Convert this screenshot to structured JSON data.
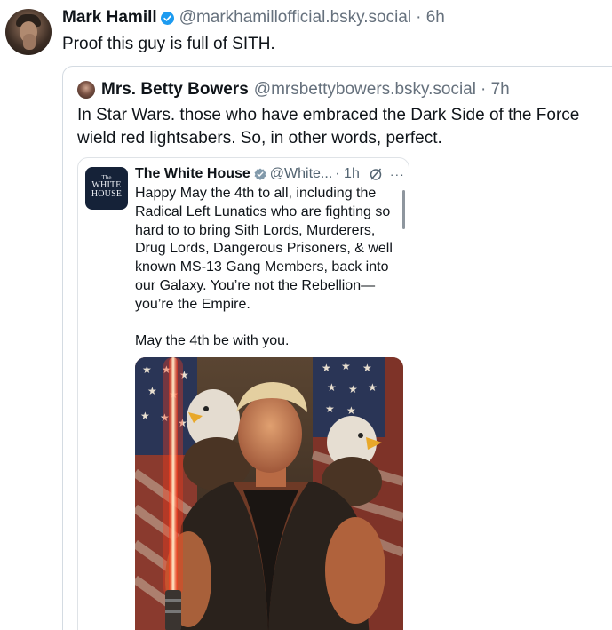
{
  "post": {
    "author_name": "Mark Hamill",
    "handle": "@markhamillofficial.bsky.social",
    "time": "· 6h",
    "text": "Proof this guy is full of SITH."
  },
  "quote": {
    "author_name": "Mrs. Betty Bowers",
    "handle": "@mrsbettybowers.bsky.social",
    "time": "· 7h",
    "text": "In Star Wars. those who have embraced the Dark Side of the Force wield red lightsabers. So, in other words, perfect."
  },
  "embed": {
    "logo_line1": "The",
    "logo_line2a": "WHITE",
    "logo_line2b": "HOUSE",
    "author_name": "The White House",
    "handle": "@White...",
    "time": "· 1h",
    "more": "···",
    "text_para1": "Happy May the 4th to all, including the Radical Left Lunatics who are fighting so hard to to bring Sith Lords, Murderers, Drug Lords, Dangerous Prisoners, & well known MS-13 Gang Members, back into our Galaxy. You’re not the Rebellion—you’re the Empire.",
    "text_para2": "May the 4th be with you.",
    "image_icon": "illustration-image"
  },
  "colors": {
    "verified_blue": "#1d9bf0",
    "handle_gray": "#66717d",
    "wh_navy": "#152238",
    "lightsaber_red": "#ff3b1a"
  }
}
